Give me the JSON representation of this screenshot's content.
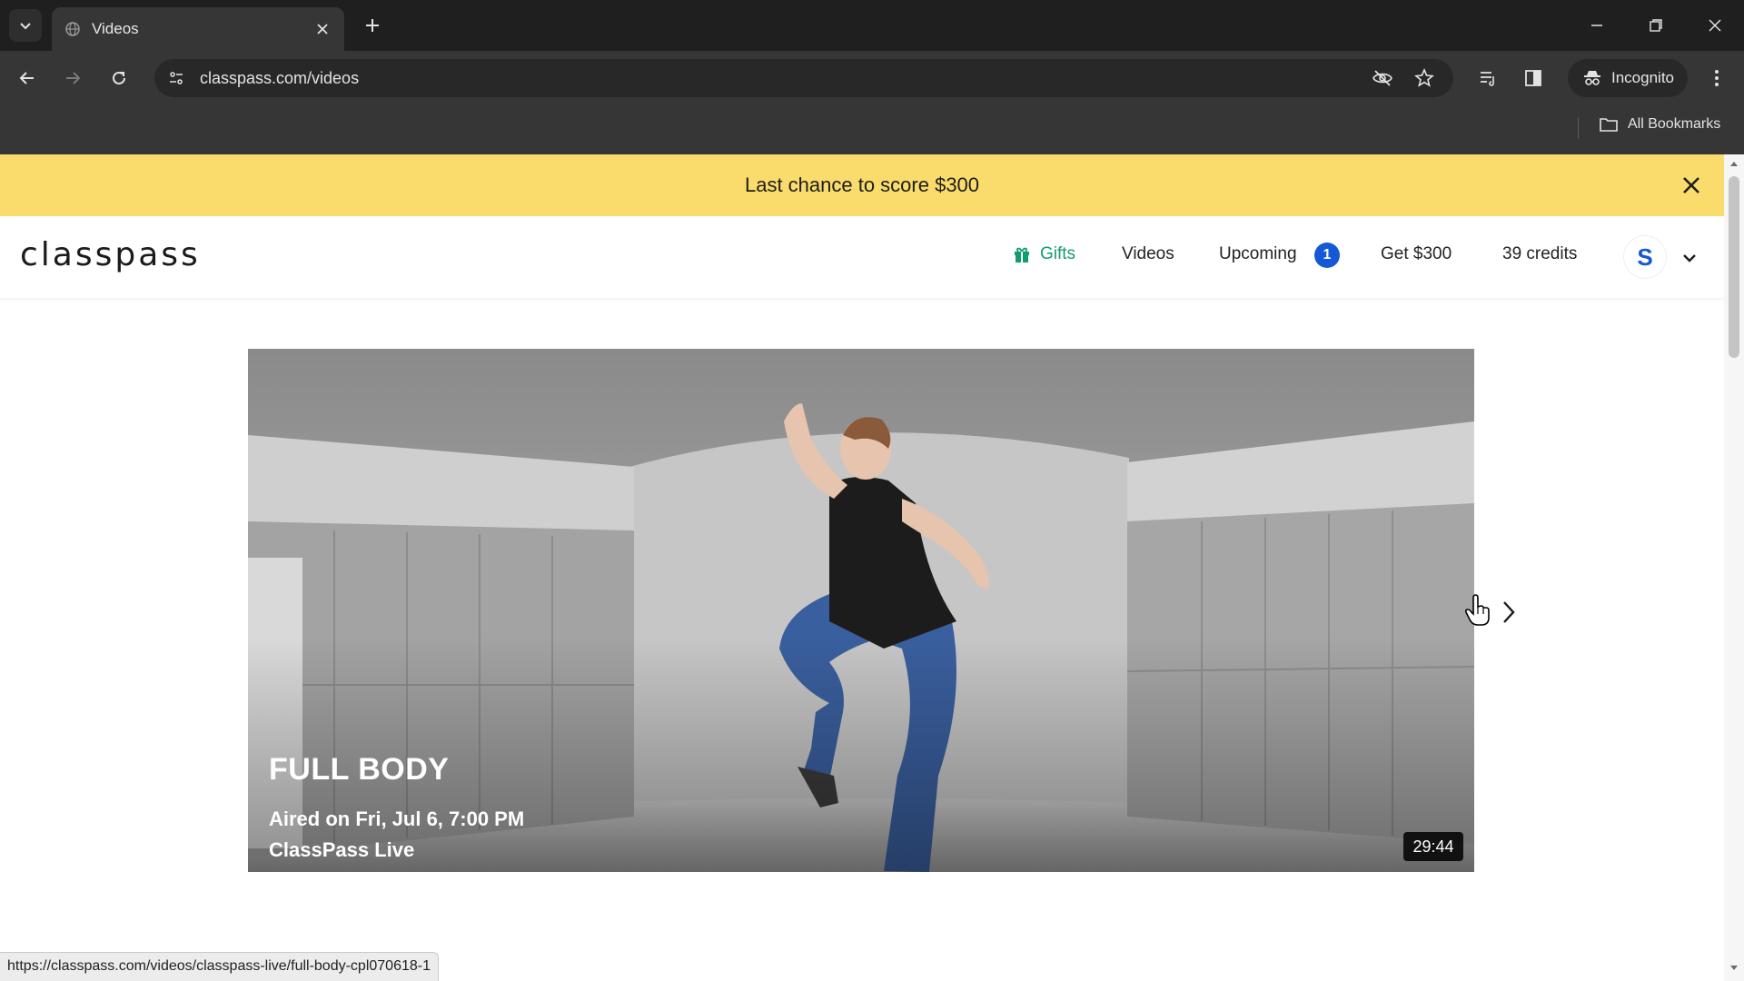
{
  "browser": {
    "tab_title": "Videos",
    "url": "classpass.com/videos",
    "incognito_label": "Incognito",
    "bookmarks_label": "All Bookmarks",
    "status_url": "https://classpass.com/videos/classpass-live/full-body-cpl070618-1"
  },
  "promo": {
    "text": "Last chance to score $300"
  },
  "header": {
    "logo": "classpass",
    "nav": {
      "gifts": "Gifts",
      "videos": "Videos",
      "upcoming": "Upcoming",
      "upcoming_count": "1",
      "get_offer": "Get $300",
      "credits": "39 credits"
    },
    "avatar_initial": "S"
  },
  "hero": {
    "title": "FULL BODY",
    "aired": "Aired on Fri, Jul 6, 7:00 PM",
    "source": "ClassPass Live",
    "duration": "29:44"
  },
  "colors": {
    "promo_bg": "#f9dc6b",
    "accent_blue": "#1458d6",
    "gifts_green": "#139c6c",
    "chrome_dark": "#1f1f1f",
    "chrome_toolbar": "#363636"
  },
  "icons": [
    "tab-search-icon",
    "globe-favicon-icon",
    "close-icon",
    "plus-icon",
    "minimize-icon",
    "restore-icon",
    "back-icon",
    "forward-icon",
    "reload-icon",
    "site-info-icon",
    "eye-off-icon",
    "star-icon",
    "reading-list-icon",
    "side-panel-icon",
    "incognito-icon",
    "kebab-menu-icon",
    "folder-icon",
    "gift-icon",
    "chevron-down-icon",
    "chevron-right-icon",
    "hand-cursor-icon"
  ]
}
